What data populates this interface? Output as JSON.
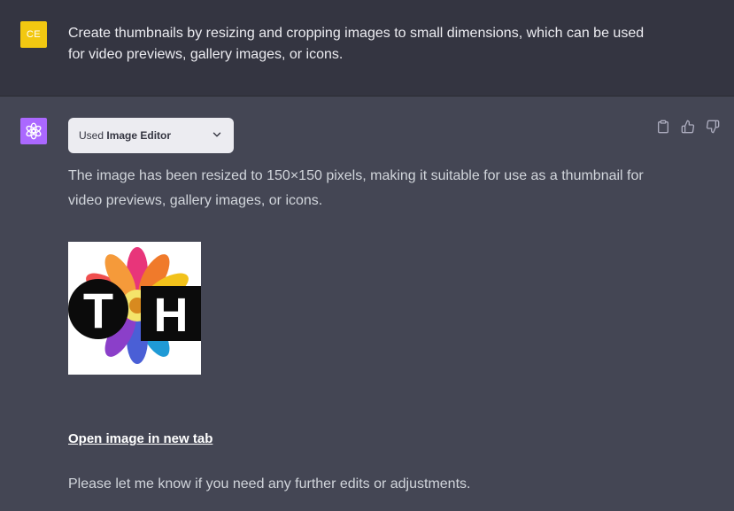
{
  "user_message": {
    "avatar_initials": "CE",
    "avatar_color": "#f2c811",
    "text": "Create thumbnails by resizing and cropping images to small dimensions, which can be used for video previews, gallery images, or icons."
  },
  "assistant_message": {
    "avatar_icon": "openai-logo-icon",
    "avatar_color": "#ab68ff",
    "tool_pill": {
      "prefix": "Used",
      "tool_name": "Image Editor",
      "icon": "chevron-down-icon"
    },
    "actions": [
      "clipboard-icon",
      "thumbs-up-icon",
      "thumbs-down-icon"
    ],
    "paragraph_1": "The image has been resized to 150×150 pixels, making it suitable for use as a thumbnail for video previews, gallery images, or icons.",
    "thumbnail": {
      "letter_left": "T",
      "letter_right": "H"
    },
    "link_text": "Open image in new tab",
    "paragraph_2": "Please let me know if you need any further edits or adjustments."
  },
  "colors": {
    "user_bg": "#343541",
    "assistant_bg": "#444654",
    "pill_bg": "#ececf1"
  }
}
